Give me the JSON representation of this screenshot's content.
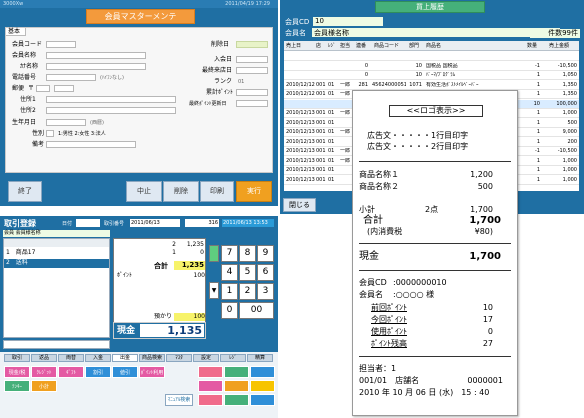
{
  "member_master": {
    "title_bar_left": "3000Xw",
    "title_bar_right": "2011/04/19 17:29",
    "title": "会員マスターメンテ",
    "tab": "基本",
    "labels": {
      "member_code": "会員コード",
      "member_name": "会員名称",
      "kana": "ｶﾅ名称",
      "phone": "電話番号",
      "phone_hint": "(ﾊｲﾌﾝなし)",
      "postal": "郵便",
      "postal_mark": "〒",
      "address1": "住所1",
      "address2": "住所2",
      "birthday": "生年月日",
      "birthday_hint": "(西暦)",
      "gender": "性別",
      "gender_options": "1:男性 2:女性 3:法人",
      "remarks": "備考",
      "deleted": "削除日",
      "joined": "入会日",
      "last_visit": "最終来店日",
      "rank": "ランク",
      "cumulative_points": "累計ﾎﾟｲﾝﾄ",
      "last_point_update": "最終ﾎﾟｲﾝﾄ更新日"
    },
    "values": {
      "rank": "01"
    },
    "buttons": {
      "exit": "終了",
      "cancel": "中止",
      "delete": "削除",
      "print": "印刷",
      "execute": "実行"
    }
  },
  "purchase_history": {
    "title": "買上履歴",
    "member_cd_label": "会員CD",
    "member_cd": "10",
    "member_name_label": "会員名",
    "member_name": "会員様名称",
    "count": "件数99件",
    "columns": [
      "売上日",
      "店",
      "ﾚｼﾞ",
      "担当",
      "連番",
      "商品コード",
      "部門",
      "商品名",
      "数量",
      "売上金額"
    ],
    "rows": [
      {
        "date": "",
        "store": "",
        "reg": "",
        "staff": "",
        "seq": "",
        "code": "",
        "dept": "",
        "name": "",
        "qty": "",
        "amount": ""
      },
      {
        "date": "",
        "store": "",
        "reg": "",
        "staff": "",
        "seq": "0",
        "code": "",
        "dept": "10",
        "name": "国税品 国税品",
        "qty": "-1",
        "amount": "-10,500"
      },
      {
        "date": "",
        "store": "",
        "reg": "",
        "staff": "",
        "seq": "0",
        "code": "",
        "dept": "10",
        "name": "ﾊﾟｰﾏ/ﾌﾟﾛｸﾞﾗﾑ",
        "qty": "1",
        "amount": "1,050"
      },
      {
        "date": "2010/12/12",
        "store": "001",
        "reg": "01",
        "staff": "一郎",
        "seq": "281",
        "code": "45624000051",
        "dept": "1071",
        "name": "有効生活ﾎﾟｽﾄﾒｲﾙﾍﾟｰﾊﾟｰ",
        "qty": "1",
        "amount": "1,350"
      },
      {
        "date": "2010/12/12",
        "store": "001",
        "reg": "01",
        "staff": "一郎",
        "seq": "285",
        "code": "45624000051",
        "dept": "1071",
        "name": "有効生活ﾎﾟｽﾄﾒｲﾙﾍﾟｰﾊﾟｰ",
        "qty": "1",
        "amount": "1,350"
      },
      {
        "date": "",
        "store": "",
        "reg": "",
        "staff": "",
        "seq": "",
        "code": "",
        "dept": "",
        "name": "",
        "qty": "10",
        "amount": "100,000"
      },
      {
        "date": "2010/12/13",
        "store": "001",
        "reg": "01",
        "staff": "一郎",
        "seq": "",
        "code": "",
        "dept": "",
        "name": "",
        "qty": "1",
        "amount": "1,000"
      },
      {
        "date": "2010/12/13",
        "store": "001",
        "reg": "01",
        "staff": "",
        "seq": "",
        "code": "",
        "dept": "",
        "name": "",
        "qty": "1",
        "amount": "500"
      },
      {
        "date": "2010/12/13",
        "store": "001",
        "reg": "01",
        "staff": "一郎",
        "seq": "",
        "code": "",
        "dept": "",
        "name": "",
        "qty": "1",
        "amount": "9,000"
      },
      {
        "date": "2010/12/13",
        "store": "001",
        "reg": "01",
        "staff": "",
        "seq": "",
        "code": "",
        "dept": "",
        "name": "",
        "qty": "1",
        "amount": "200"
      },
      {
        "date": "2010/12/13",
        "store": "001",
        "reg": "01",
        "staff": "一郎",
        "seq": "",
        "code": "",
        "dept": "",
        "name": "",
        "qty": "-1",
        "amount": "-10,500"
      },
      {
        "date": "2010/12/13",
        "store": "001",
        "reg": "01",
        "staff": "一郎",
        "seq": "",
        "code": "",
        "dept": "",
        "name": "",
        "qty": "1",
        "amount": "1,000"
      },
      {
        "date": "2010/12/13",
        "store": "001",
        "reg": "01",
        "staff": "",
        "seq": "",
        "code": "",
        "dept": "",
        "name": "",
        "qty": "1",
        "amount": "1,000"
      },
      {
        "date": "2010/12/13",
        "store": "001",
        "reg": "01",
        "staff": "",
        "seq": "",
        "code": "",
        "dept": "",
        "name": "",
        "qty": "1",
        "amount": "1,000"
      }
    ],
    "close_button": "閉じる"
  },
  "pos": {
    "title": "取引登録",
    "header_fields": "日付",
    "header_date": "2011/06/13",
    "receipt_no_label": "取引番号",
    "receipt_no": "316",
    "datetime": "2011/06/13 13:53",
    "customer_label": "会員",
    "customer": "会員様名称",
    "items": [
      {
        "no": "1",
        "name": "商品17",
        "qty": "2",
        "price": "1,235"
      },
      {
        "no": "2",
        "name": "送料",
        "qty": "1",
        "price": "0"
      }
    ],
    "subtotal_label": "合計",
    "subtotal": "1,235",
    "points_label": "ﾎﾟｲﾝﾄ",
    "points": "100",
    "deposit_label": "預かり",
    "deposit": "100",
    "cash_label": "現金",
    "cash": "1,135",
    "keys": [
      "7",
      "8",
      "9",
      "4",
      "5",
      "6",
      "1",
      "2",
      "3",
      "0",
      "00"
    ],
    "function_tabs": [
      "取引",
      "返品",
      "両替",
      "入金",
      "出金",
      "商品検索",
      "ﾏｽﾀ",
      "設定",
      "ﾚｼﾞ",
      "精算"
    ],
    "function_keys": [
      "現金/税",
      "ｸﾚｼﾞｯﾄ",
      "ｷﾞﾌﾄ",
      "割引",
      "値引",
      "ﾎﾟｲﾝﾄ利用",
      "ﾃﾝｷｰ",
      "小計"
    ],
    "wide_button": "ﾏﾆｭｱﾙ検索"
  },
  "receipt": {
    "logo": "<<ロゴ表示>>",
    "ad1": "広告文・・・・・1行目印字",
    "ad2": "広告文・・・・・2行目印字",
    "item1_name": "商品名称１",
    "item1_price": "1,200",
    "item2_name": "商品名称２",
    "item2_price": "500",
    "subtotal_label": "小計",
    "subtotal_qty": "2点",
    "subtotal": "1,700",
    "total_label": "合計",
    "total": "1,700",
    "tax_label": "(内消費税",
    "tax": "¥80)",
    "cash_label": "現金",
    "cash": "1,700",
    "member_cd_label": "会員CD",
    "member_cd": ":0000000010",
    "member_name_label": "会員名",
    "member_name": ":○○○○ 様",
    "prev_points_label": "前回ﾎﾟｲﾝﾄ",
    "prev_points": "10",
    "this_points_label": "今回ﾎﾟｲﾝﾄ",
    "this_points": "17",
    "used_points_label": "使用ﾎﾟｲﾝﾄ",
    "used_points": "0",
    "balance_label": "ﾎﾟｲﾝﾄ残高",
    "balance": "27",
    "staff": "担当者：1",
    "store_line": "001/01　店舗名",
    "receipt_no": "0000001",
    "datetime": "2010 年 10 月 06 日 (水)　15 : 40"
  },
  "colors": {
    "window_blue": "#1f6fa3",
    "orange": "#f39a3c",
    "green": "#45b07a",
    "execute_orange": "#f0a020"
  }
}
